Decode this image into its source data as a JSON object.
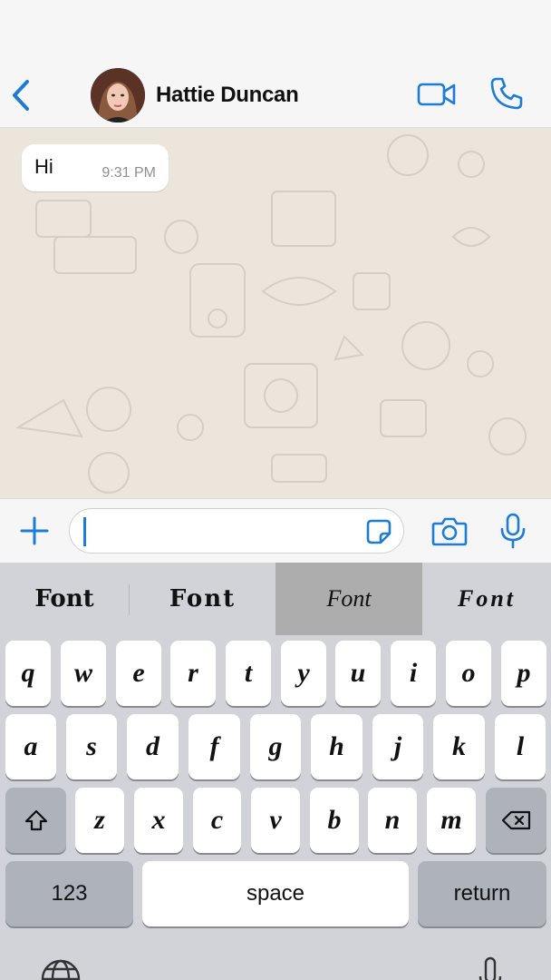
{
  "header": {
    "contact_name": "Hattie Duncan",
    "back_icon": "chevron-left-icon",
    "video_icon": "video-camera-icon",
    "call_icon": "phone-icon",
    "accent": "#1c7cd6"
  },
  "messages": [
    {
      "text": "Hi",
      "time": "9:31 PM",
      "direction": "incoming"
    }
  ],
  "input_bar": {
    "value": "",
    "plus_icon": "plus-icon",
    "sticker_icon": "sticker-icon",
    "camera_icon": "camera-icon",
    "mic_icon": "microphone-icon"
  },
  "keyboard": {
    "suggestions": [
      {
        "label": "Font",
        "selected": false
      },
      {
        "label": "Font",
        "selected": false
      },
      {
        "label": "Font",
        "selected": true
      },
      {
        "label": "Font",
        "selected": false
      }
    ],
    "row1": [
      "q",
      "w",
      "e",
      "r",
      "t",
      "y",
      "u",
      "i",
      "o",
      "p"
    ],
    "row2": [
      "a",
      "s",
      "d",
      "f",
      "g",
      "h",
      "j",
      "k",
      "l"
    ],
    "row3": [
      "z",
      "x",
      "c",
      "v",
      "b",
      "n",
      "m"
    ],
    "numbers_label": "123",
    "space_label": "space",
    "return_label": "return",
    "shift_icon": "shift-icon",
    "delete_icon": "backspace-icon",
    "globe_icon": "globe-icon",
    "dictation_icon": "dictation-mic-icon"
  }
}
